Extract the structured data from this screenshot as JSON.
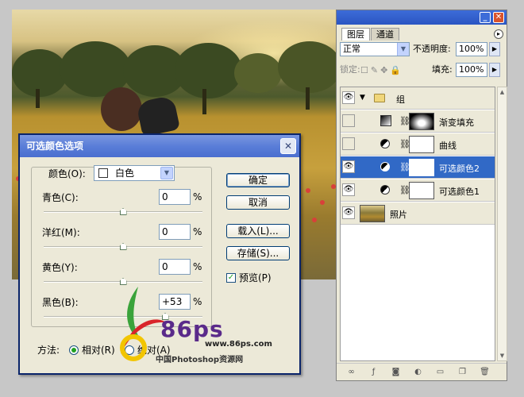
{
  "layers_panel": {
    "tabs": [
      {
        "label": "图层"
      },
      {
        "label": "通道"
      }
    ],
    "blend_mode": "正常",
    "opacity_label": "不透明度:",
    "opacity_value": "100%",
    "lock_label": "锁定:",
    "fill_label": "填充:",
    "fill_value": "100%",
    "layers": [
      {
        "name": "组",
        "kind": "group",
        "visible": true,
        "selected": false
      },
      {
        "name": "渐变填充",
        "kind": "gradient-fill",
        "visible": false,
        "selected": false
      },
      {
        "name": "曲线",
        "kind": "adjustment",
        "visible": false,
        "selected": false
      },
      {
        "name": "可选颜色2",
        "kind": "adjustment",
        "visible": true,
        "selected": true
      },
      {
        "name": "可选颜色1",
        "kind": "adjustment",
        "visible": true,
        "selected": false
      },
      {
        "name": "照片",
        "kind": "image",
        "visible": true,
        "selected": false
      }
    ]
  },
  "dialog": {
    "title": "可选颜色选项",
    "color_label": "颜色(O):",
    "color_value": "白色",
    "sliders": [
      {
        "label": "青色(C):",
        "value": "0",
        "unit": "%",
        "level": 0
      },
      {
        "label": "洋红(M):",
        "value": "0",
        "unit": "%",
        "level": 0
      },
      {
        "label": "黄色(Y):",
        "value": "0",
        "unit": "%",
        "level": 0
      },
      {
        "label": "黑色(B):",
        "value": "+53",
        "unit": "%",
        "level": 53
      }
    ],
    "buttons": {
      "ok": "确定",
      "cancel": "取消",
      "load": "载入(L)...",
      "save": "存储(S)..."
    },
    "preview_label": "预览(P)",
    "preview_checked": true,
    "method_label": "方法:",
    "method_options": [
      {
        "label": "相对(R)",
        "selected": true
      },
      {
        "label": "绝对(A)",
        "selected": false
      }
    ]
  },
  "watermark": {
    "logo_text": "86ps",
    "url": "www.86ps.com",
    "site_name": "中国Photoshop资源网"
  },
  "colors": {
    "title_bar": "#4a6ecf",
    "selected_layer": "#3169c6",
    "panel_bg": "#ece9d8"
  }
}
